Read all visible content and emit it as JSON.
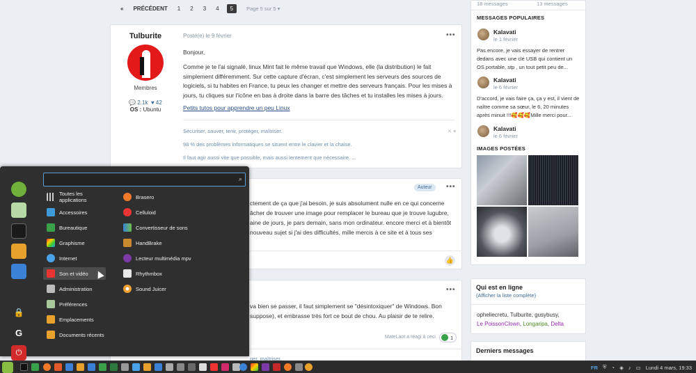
{
  "pagination": {
    "first": "«",
    "prev": "PRÉCÉDENT",
    "pages": [
      "1",
      "2",
      "3",
      "4",
      "5"
    ],
    "current": "5",
    "page_of": "Page 5 sur 5 ▾"
  },
  "post1": {
    "author": "Tulburite",
    "role": "Membres",
    "posts": "2.1k",
    "reputation": "42",
    "os_label": "OS :",
    "os_value": "Ubuntu",
    "date": "Posté(e) le 9 février",
    "menu": "•••",
    "greeting": "Bonjour,",
    "body": "Comme je te l'ai signalé, linux Mint fait le même travail que Windows, elle (la distribution) le fait simplement différemment. Sur cette capture d'écran, c'est simplement les serveurs des sources de logiciels, si tu habites en France, tu peux les changer et mettre des serveurs français. Pour les mises à jours, tu cliques sur l'icône en bas à droite dans la barre des tâches et tu installes les mises à jours.",
    "link": "Petits tutos pour apprendre un peu Linux",
    "sig1": "Sécuriser, sauver, tenir, protéger, maîtriser.",
    "sig2": "98 % des problèmes informatiques se situent entre le clavier et la chaise.",
    "sig3": "Il faut agir aussi vite que possible, mais aussi lentement que nécessaire. ...",
    "sig_close": "✕ ▾"
  },
  "post2": {
    "badge": "Auteur",
    "menu": "•••",
    "line1": "ctement de ça que j'ai besoin, je suis absolument nulle en ce qui concerne",
    "line2": "âcher de trouver une image pour remplacer le bureau que je trouve lugubre,",
    "line3": "aine de jours, je pars demain, sans mon ordinateur. encore merci et à bientôt",
    "line4": "nouveau sujet si j'ai des difficultés, mille mercis à ce site et à tous ses"
  },
  "post3": {
    "menu": "•••",
    "line1": "va bien se passer, il faut simplement se \"désintoxiquer\" de Windows. Bon",
    "line2": "suppose), et embrasse très fort ce bout de chou. Au plaisir de te relire.",
    "reaction_text": "MateLaot a réagi à ceci",
    "reaction_count": "1",
    "sig": "ger, maîtriser."
  },
  "stats": {
    "left": "18 messages",
    "right": "13 messages"
  },
  "popular": {
    "heading": "MESSAGES POPULAIRES",
    "items": [
      {
        "name": "Kalavati",
        "date": "le 1 février",
        "text": "Pas encore, je vais essayer de rentrer dedans avec une clé USB qui contient un OS portable, stp , un tout petit peu de..."
      },
      {
        "name": "Kalavati",
        "date": "le 6 février",
        "text": "D'accord, je vais faire ça, ça y est, il vient de naître comme sa sœur, le 6,  20 minutes après minuit !!!🥰🥰🥰Mille merci pour..."
      },
      {
        "name": "Kalavati",
        "date": "le 6 février"
      }
    ]
  },
  "images": {
    "heading": "IMAGES POSTÉES"
  },
  "online": {
    "title": "Qui est en ligne",
    "subtitle": "(Afficher la liste complète)",
    "users_line": "opheliecretu, Tulburite, gusybusy,",
    "user_a": "Le PoissonClown",
    "user_b": "Longaripa",
    "user_c": "Delta",
    "sep": ", "
  },
  "derniers": {
    "title": "Derniers messages"
  },
  "menu": {
    "search_placeholder": "",
    "categories": [
      "Toutes les applications",
      "Accessoires",
      "Bureautique",
      "Graphisme",
      "Internet",
      "Son et vidéo",
      "Administration",
      "Préférences",
      "Emplacements",
      "Documents récents"
    ],
    "apps": [
      "Brasero",
      "Celluloid",
      "Convertisseur de sons",
      "HandBrake",
      "Lecteur multimédia mpv",
      "Rhythmbox",
      "Sound Juicer"
    ],
    "selected": "Son et vidéo"
  },
  "taskbar": {
    "lang": "FR",
    "clock": "Lundi 4 mars, 19:33"
  },
  "colors": {
    "accent": "#5a9fd8",
    "link": "#2a4e8a",
    "mint": "#8cc152"
  }
}
